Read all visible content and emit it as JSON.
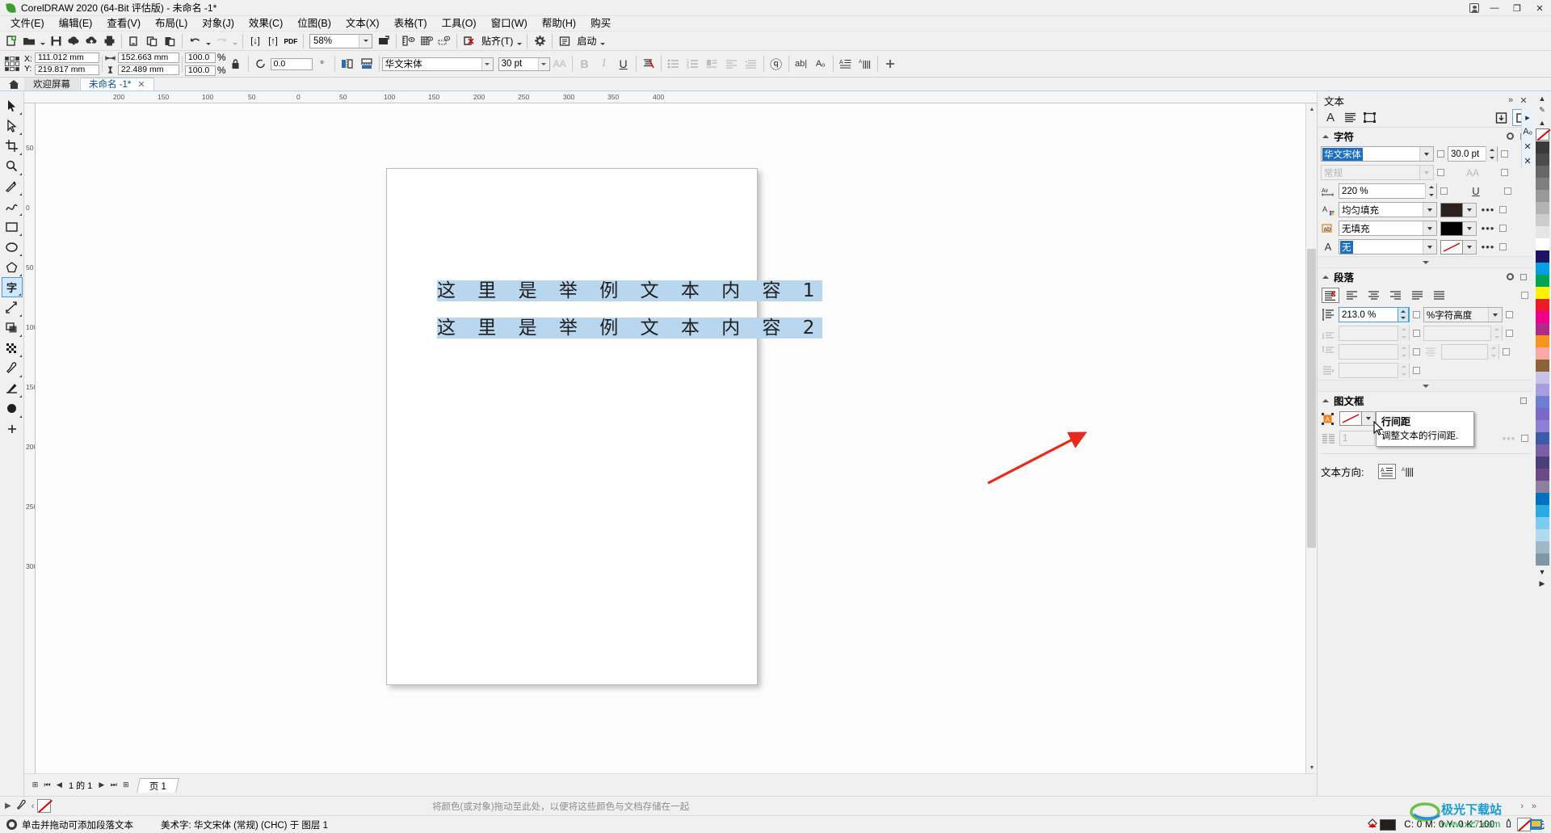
{
  "window": {
    "title": "CorelDRAW 2020 (64-Bit 评估版) - 未命名 -1*",
    "minimize": "—",
    "maximize": "❐",
    "close": "✕"
  },
  "menu": {
    "items": [
      {
        "label": "文件(E)"
      },
      {
        "label": "编辑(E)"
      },
      {
        "label": "查看(V)"
      },
      {
        "label": "布局(L)"
      },
      {
        "label": "对象(J)"
      },
      {
        "label": "效果(C)"
      },
      {
        "label": "位图(B)"
      },
      {
        "label": "文本(X)"
      },
      {
        "label": "表格(T)"
      },
      {
        "label": "工具(O)"
      },
      {
        "label": "窗口(W)"
      },
      {
        "label": "帮助(H)"
      },
      {
        "label": "购买"
      }
    ]
  },
  "toolbar": {
    "new_icon": "new-document-icon",
    "open_icon": "open-folder-icon",
    "save_icon": "save-icon",
    "cloud_down_icon": "cloud-download-icon",
    "cloud_up_icon": "cloud-upload-icon",
    "print_icon": "print-icon",
    "cut_icon": "cut-icon",
    "copy_icon": "copy-icon",
    "paste_icon": "paste-icon",
    "undo_icon": "undo-icon",
    "redo_icon": "redo-icon",
    "import_label": "[↓]",
    "export_label": "[↑]",
    "pdf_label": "PDF",
    "zoom_value": "58%",
    "fullscreen_icon": "full-screen-preview-icon",
    "ruler_icon": "show-rulers-icon",
    "grid_icon": "show-grid-icon",
    "guides_icon": "show-guides-icon",
    "snap_off_icon": "snap-off-icon",
    "snap_label": "贴齐(T)",
    "options_icon": "options-gear-icon",
    "launch_label": "启动"
  },
  "propbar": {
    "x_label": "X:",
    "y_label": "Y:",
    "x_value": "111.012 mm",
    "y_value": "219.817 mm",
    "w_value": "152.663 mm",
    "h_value": "22.489 mm",
    "scale_x": "100.0",
    "scale_y": "100.0",
    "percent": "%",
    "lock_icon": "lock-ratio-icon",
    "rotation_value": "0.0",
    "degree_symbol": "°",
    "mirror_h_icon": "mirror-horizontal-icon",
    "mirror_v_icon": "mirror-vertical-icon",
    "font_family": "华文宋体",
    "font_size": "30 pt",
    "case_icon": "change-case-icon",
    "bold_label": "B",
    "italic_label": "I",
    "underline_label": "U",
    "strike_icon": "text-strike-icon",
    "bullet_icon": "bulleted-list-icon",
    "number_icon": "numbered-list-icon",
    "drop_cap_icon": "drop-cap-icon",
    "align_icon": "text-align-icon",
    "indent_icon": "indent-icon",
    "interactive_icon": "interactive-ol-icon",
    "char_icon": "character-icon",
    "edit_text_icon": "edit-text-icon",
    "direction_icon": "text-direction-icon",
    "plus_icon": "add-more-icon"
  },
  "doctabs": {
    "home_icon": "home-icon",
    "items": [
      {
        "label": "欢迎屏幕",
        "active": false
      },
      {
        "label": "未命名 -1*",
        "active": true
      }
    ],
    "close_label": "✕"
  },
  "toolbox": {
    "items": [
      {
        "name": "pick-tool",
        "glyph": "↖",
        "selected": false
      },
      {
        "name": "shape-tool",
        "glyph": "⤵",
        "selected": false
      },
      {
        "name": "crop-tool",
        "glyph": "✛",
        "selected": false
      },
      {
        "name": "zoom-tool",
        "glyph": "⚲",
        "selected": false
      },
      {
        "name": "freehand-tool",
        "glyph": "✐",
        "selected": false
      },
      {
        "name": "artistic-media-tool",
        "glyph": "⌇",
        "selected": false
      },
      {
        "name": "rectangle-tool",
        "glyph": "▭",
        "selected": false
      },
      {
        "name": "ellipse-tool",
        "glyph": "○",
        "selected": false
      },
      {
        "name": "polygon-tool",
        "glyph": "⬠",
        "selected": false
      },
      {
        "name": "text-tool",
        "glyph": "字",
        "selected": true
      },
      {
        "name": "parallel-dimension-tool",
        "glyph": "↗",
        "selected": false
      },
      {
        "name": "drop-shadow-tool",
        "glyph": "▣",
        "selected": false
      },
      {
        "name": "transparency-tool",
        "glyph": "▒",
        "selected": false
      },
      {
        "name": "color-eyedropper-tool",
        "glyph": "✒",
        "selected": false
      },
      {
        "name": "interactive-fill-tool",
        "glyph": "◢",
        "selected": false
      },
      {
        "name": "smart-fill-tool",
        "glyph": "⬤",
        "selected": false
      },
      {
        "name": "add-tool",
        "glyph": "＋",
        "selected": false
      }
    ]
  },
  "canvas": {
    "text_lines": [
      {
        "text": "这 里 是 举 例 文 本 内 容 1",
        "highlighted": true
      },
      {
        "text": "这 里 是 举 例 文 本 内 容 2",
        "highlighted": true
      }
    ],
    "ruler_h_ticks": [
      "200",
      "150",
      "100",
      "50",
      "0",
      "50",
      "100",
      "150",
      "200",
      "250",
      "300",
      "350",
      "400"
    ],
    "ruler_v_ticks": [
      "50",
      "0",
      "50",
      "100",
      "150",
      "200",
      "250",
      "300"
    ],
    "highlight_color": "#b9d6ef",
    "annotation_arrow_color": "#e8291c"
  },
  "pagenav": {
    "first_label": "⏮",
    "prev_page_label": "◀◀",
    "prev_label": "◀",
    "counter": "1 的 1",
    "next_label": "▶",
    "next_page_label": "▶▶",
    "last_label": "⏭",
    "page_tab": "页 1"
  },
  "bottombar": {
    "hint": "将颜色(或对象)拖动至此处，以便将这些颜色与文档存储在一起",
    "expand_left": "▶",
    "eyedrop_icon": "eyedropper-icon",
    "nav_left": "‹",
    "none_swatch_icon": "no-color-icon",
    "nav_right_1": "›",
    "nav_right_2": "»"
  },
  "statusbar": {
    "gear_icon": "status-gear-icon",
    "hint": "单击并拖动可添加段落文本",
    "object_info": "美术字:  华文宋体 (常规) (CHC) 于 图层 1",
    "fill_swatch_color": "#231f1c",
    "cmyk": "C:  0 M:  0 Y:  0 K:  100",
    "outline_label": "无",
    "watermark_title": "极光下载站",
    "watermark_url": "www.xz7.com"
  },
  "docker": {
    "title": "文本",
    "collapse_icon": "»",
    "close_icon": "✕",
    "tabs": [
      {
        "name": "character-tab",
        "glyph": "A",
        "selected": false
      },
      {
        "name": "paragraph-tab",
        "glyph": "☰",
        "selected": false
      },
      {
        "name": "frame-tab",
        "glyph": "⬚",
        "selected": false
      }
    ],
    "save_style_icon": "save-style-icon",
    "new_style_icon": "new-style-icon",
    "character": {
      "title": "字符",
      "font_family": "华文宋体",
      "font_size": "30.0 pt",
      "font_style": "常规",
      "case_icon": "change-case-icon",
      "range_kerning": "220 %",
      "underline_icon": "underline-icon",
      "fill_type": "均匀填充",
      "fill_color": "#2b211d",
      "outline_fill": "无填充",
      "outline_color": "#000000",
      "background": "无",
      "background_swatch": "none",
      "dots": "•••"
    },
    "paragraph": {
      "title": "段落",
      "align_buttons": [
        {
          "name": "align-none",
          "selected": true
        },
        {
          "name": "align-left",
          "selected": false
        },
        {
          "name": "align-center",
          "selected": false
        },
        {
          "name": "align-right",
          "selected": false
        },
        {
          "name": "align-justify",
          "selected": false
        },
        {
          "name": "align-force-justify",
          "selected": false
        }
      ],
      "line_spacing_value": "213.0 %",
      "line_spacing_unit": "%字符高度",
      "space_before": "",
      "space_after": "",
      "left_indent": "",
      "first_line_indent": "",
      "right_indent": "",
      "char_spacing": ""
    },
    "frame": {
      "title": "图文框",
      "fill_swatch": "none",
      "vertical_align_icon": "vertical-align-icon",
      "columns_icon": "columns-icon",
      "columns_value": "1",
      "text_flow_icon": "text-flow-icon",
      "dots": "•••"
    },
    "text_direction": {
      "label": "文本方向:",
      "horizontal_icon": "horizontal-text-icon",
      "vertical_icon": "vertical-text-icon"
    }
  },
  "tooltip": {
    "title": "行间距",
    "body": "调整文本的行间距."
  },
  "palette": {
    "up_arrow": "▲",
    "down_arrow": "▼",
    "more_arrow": "▶",
    "none_label": "none-color-swatch",
    "colors": [
      "#ffffff",
      "#e0e0e0",
      "#c6c6c6",
      "#ababab",
      "#8f8f8f",
      "#757575",
      "#5c5c5c",
      "#424242",
      "#2b2b2b",
      "#000000",
      "#1b1464",
      "#00a0e3",
      "#00a651",
      "#fff200",
      "#ed1c24",
      "#ec008c",
      "#a349a4",
      "#7f3f98",
      "#f7941d",
      "#f9a8a8",
      "#8c6239",
      "#c7c2e8",
      "#9e8fd4",
      "#6c7fd0",
      "#7b68c8",
      "#8f7fd4",
      "#3b5ba9",
      "#7a5fa8",
      "#4a3f7a",
      "#6d4a86",
      "#8d7fa0",
      "#6699cc",
      "#0072bc",
      "#29abe2",
      "#7accf0",
      "#b3d9ef",
      "#9fb8c8",
      "#8097a8"
    ]
  }
}
